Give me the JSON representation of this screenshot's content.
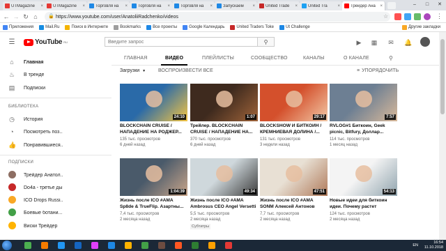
{
  "browser": {
    "tabs": [
      {
        "title": "UTMagazine",
        "color": "#e53935"
      },
      {
        "title": "UTMagazine",
        "color": "#e53935"
      },
      {
        "title": "Торговля на",
        "color": "#1e88e5"
      },
      {
        "title": "Торговля на",
        "color": "#1e88e5"
      },
      {
        "title": "Торговля на",
        "color": "#1e88e5"
      },
      {
        "title": "Запускаем",
        "color": "#1e88e5"
      },
      {
        "title": "United Trade",
        "color": "#c62828"
      },
      {
        "title": "United Tra",
        "color": "#1da1f2"
      },
      {
        "title": "Трейдер Ана",
        "color": "#ff0000"
      }
    ],
    "url": "https://www.youtube.com/user/AnatoliiRadchenko/videos",
    "bookmarks": [
      {
        "label": "Приложения",
        "color": "#4285f4"
      },
      {
        "label": "Mail.Ru",
        "color": "#168de2"
      },
      {
        "label": "Поиск в Интернете",
        "color": "#f4b400"
      },
      {
        "label": "Bookmarks",
        "color": "#9e9e9e"
      },
      {
        "label": "Все проекты",
        "color": "#1e88e5"
      },
      {
        "label": "Google Календарь",
        "color": "#4285f4"
      },
      {
        "label": "United Traders Toke",
        "color": "#c62828"
      },
      {
        "label": "Ut Challenge",
        "color": "#1e88e5"
      }
    ],
    "other_bookmarks": "Другие закладки"
  },
  "youtube": {
    "logo_text": "YouTube",
    "logo_sup": "RU",
    "search_placeholder": "Введите запрос"
  },
  "sidebar": {
    "main": [
      {
        "label": "Главная",
        "icon": "home-icon",
        "glyph": "⌂"
      },
      {
        "label": "В тренде",
        "icon": "trending-icon",
        "glyph": "♨"
      },
      {
        "label": "Подписки",
        "icon": "subscriptions-icon",
        "glyph": "▤"
      }
    ],
    "library_heading": "БИБЛИОТЕКА",
    "library": [
      {
        "label": "История",
        "icon": "history-icon",
        "glyph": "◷"
      },
      {
        "label": "Посмотреть поз...",
        "icon": "watch-later-icon",
        "glyph": "◔"
      },
      {
        "label": "Понравившиеся...",
        "icon": "liked-icon",
        "glyph": "👍"
      }
    ],
    "subs_heading": "ПОДПИСКИ",
    "subscriptions": [
      {
        "label": "Трейдер Анатол...",
        "color": "#8d6e63"
      },
      {
        "label": "Do4a - третье ды...",
        "color": "#c62828"
      },
      {
        "label": "ICO Drops Russi...",
        "color": "#f9a825"
      },
      {
        "label": "Боевые ботани...",
        "color": "#43a047"
      },
      {
        "label": "Виски Трейдер",
        "color": "#ffb300"
      }
    ]
  },
  "channel_tabs": [
    "ГЛАВНАЯ",
    "ВИДЕО",
    "ПЛЕЙЛИСТЫ",
    "СООБЩЕСТВО",
    "КАНАЛЫ",
    "О КАНАЛЕ"
  ],
  "active_tab": "ВИДЕО",
  "controls": {
    "uploads": "Загрузки",
    "play_all": "ВОСПРОИЗВЕСТИ ВСЕ",
    "sort": "УПОРЯДОЧИТЬ"
  },
  "videos": [
    {
      "title": "BLOCKCHAIN CRUISE / НАПАДЕНИЕ НА РОДЖЕР...",
      "views": "135 тыс. просмотров",
      "age": "6 дней назад",
      "duration": "24:10",
      "bg1": "#2a6aa8",
      "bg2": "#f5c542"
    },
    {
      "title": "Трейлер. BLOCKCHAIN CRUISE / НАПАДЕНИЕ НА...",
      "views": "370 тыс. просмотров",
      "age": "6 дней назад",
      "duration": "1:07",
      "bg1": "#3e2a1e",
      "bg2": "#a0643a"
    },
    {
      "title": "BLOCKSHOW И БИТКОИН / КРЕМНИЕВАЯ ДОЛИНА /...",
      "views": "131 тыс. просмотров",
      "age": "3 недели назад",
      "duration": "29:17",
      "bg1": "#d4502c",
      "bg2": "#f2c8a6"
    },
    {
      "title": "RVLOG#1 Биткоин, Geek picnic, Bitfury, Доллар...",
      "views": "114 тыс. просмотров",
      "age": "1 месяц назад",
      "duration": "7:57",
      "bg1": "#6d7f93",
      "bg2": "#d9b99a"
    },
    {
      "title": "Жизнь после ICO #AMA Sp8de & TrueFlip. Азартны...",
      "views": "7,4 тыс. просмотров",
      "age": "2 месяца назад",
      "duration": "1:04:39",
      "bg1": "#4a5a6a",
      "bg2": "#c9a58a"
    },
    {
      "title": "Жизнь после ICO #AMA Ambrosus CEO Angel Versetti",
      "views": "5,5 тыс. просмотров",
      "age": "2 месяца назад",
      "duration": "49:34",
      "bg1": "#cfd8dc",
      "bg2": "#3b3b3b",
      "badge": "Субтитры"
    },
    {
      "title": "Жизнь после ICO #AMA SONM Алексей Антонов",
      "views": "7,7 тыс. просмотров",
      "age": "2 месяца назад",
      "duration": "47:51",
      "bg1": "#e8e0d4",
      "bg2": "#b07a5a"
    },
    {
      "title": "Новые идеи для биткоин идеи. Почему растет биткоин и...",
      "views": "124 тыс. просмотров",
      "age": "2 месяца назад",
      "duration": "54:13",
      "bg1": "#f4f4f4",
      "bg2": "#90a4ae"
    }
  ],
  "taskbar": {
    "lang": "EN",
    "time": "16:54",
    "date": "11.10.2018",
    "apps": [
      "#4caf50",
      "#f57c00",
      "#2196f3",
      "#1565c0",
      "#e040fb",
      "#1e88e5",
      "#ffb300",
      "#43a047",
      "#6d4c41",
      "#ff5722",
      "#2e7d32",
      "#ffa000",
      "#e53935"
    ]
  }
}
